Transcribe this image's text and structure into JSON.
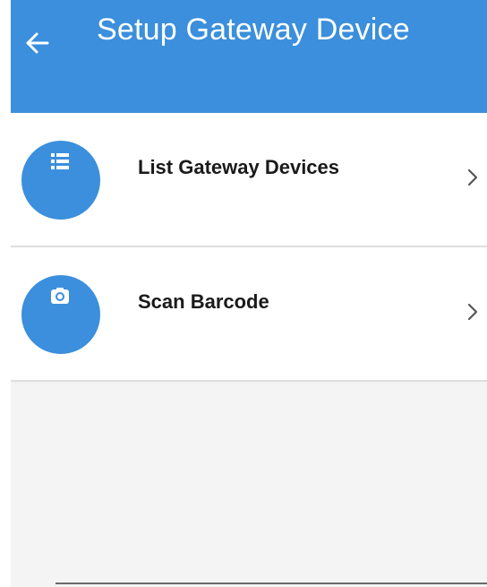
{
  "app_bar": {
    "title": "Setup Gateway Device",
    "back_icon": "arrow-left-icon",
    "background_color": "#3b8fdc"
  },
  "menu": {
    "items": [
      {
        "label": "List Gateway Devices",
        "icon": "list-icon",
        "chevron_icon": "chevron-right-icon"
      },
      {
        "label": "Scan Barcode",
        "icon": "camera-icon",
        "chevron_icon": "chevron-right-icon"
      }
    ]
  },
  "colors": {
    "accent": "#3b8fdc",
    "background": "#f4f4f4",
    "divider": "#dedede"
  }
}
